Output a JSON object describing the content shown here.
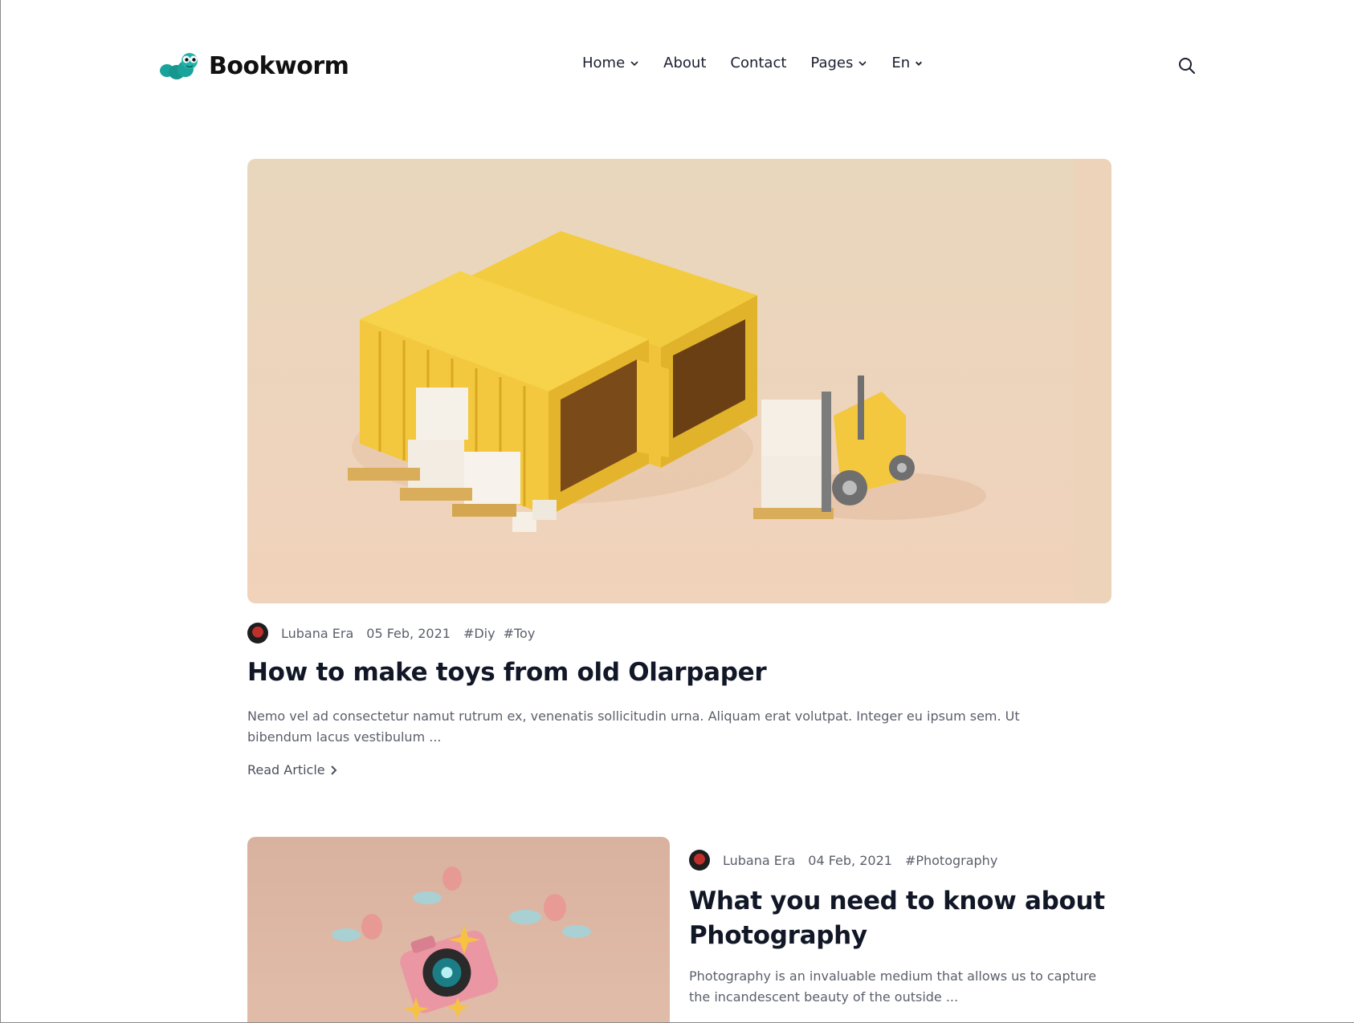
{
  "brand": {
    "name": "Bookworm",
    "accent": "#1aa39a"
  },
  "nav": {
    "items": [
      {
        "label": "Home",
        "dropdown": true
      },
      {
        "label": "About",
        "dropdown": false
      },
      {
        "label": "Contact",
        "dropdown": false
      },
      {
        "label": "Pages",
        "dropdown": true
      },
      {
        "label": "En",
        "dropdown": true
      }
    ]
  },
  "header": {
    "search_icon": "search-icon"
  },
  "featured": {
    "author": "Lubana Era",
    "date": "05 Feb, 2021",
    "tags": [
      "#Diy",
      "#Toy"
    ],
    "title": "How to make toys from old Olarpaper",
    "excerpt": "Nemo vel ad consectetur namut rutrum ex, venenatis sollicitudin urna. Aliquam erat volutpat. Integer eu ipsum sem. Ut bibendum lacus vestibulum ...",
    "read_more": "Read Article"
  },
  "post2": {
    "author": "Lubana Era",
    "date": "04 Feb, 2021",
    "tags": [
      "#Photography"
    ],
    "title": "What you need to know about Photography",
    "excerpt": "Photography is an invaluable medium that allows us to capture the incandescent beauty of the outside ..."
  }
}
